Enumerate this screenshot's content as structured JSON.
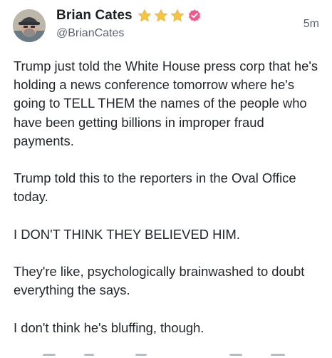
{
  "post": {
    "author": {
      "display_name": "Brian Cates",
      "handle": "@BrianCates",
      "badge_icons": [
        "star-icon",
        "star-icon",
        "star-icon"
      ],
      "verified_icon": "verified-badge-icon",
      "badge_star_color": "#f6c343",
      "verified_color": "#f05a8c"
    },
    "timestamp": "5m",
    "paragraphs": [
      "Trump just told the White House press corp that he's holding a news conference tomorrow where he's going to TELL THEM the names of the people who have been getting billions in improper fraud payments.",
      "Trump told this to the reporters in the Oval Office today.",
      "I DON'T THINK THEY BELIEVED HIM.",
      "They're like, psychologically brainwashed to doubt everything the says.",
      "I don't think he's bluffing, though."
    ]
  }
}
